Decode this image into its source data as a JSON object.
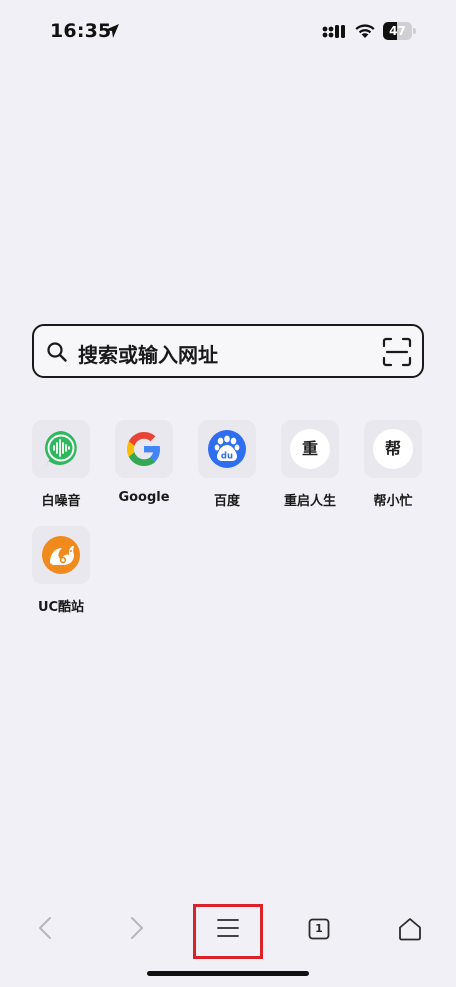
{
  "status_bar": {
    "time": "16:35",
    "battery_level": "47",
    "battery_fraction": 0.47
  },
  "search": {
    "placeholder": "搜索或输入网址"
  },
  "shortcuts": [
    {
      "label": "白噪音",
      "icon": "white-noise-app-icon",
      "color": "#2eb85c"
    },
    {
      "label": "Google",
      "icon": "google-logo-icon"
    },
    {
      "label": "百度",
      "icon": "baidu-paw-icon",
      "color": "#2e6ef0"
    },
    {
      "label": "重启人生",
      "icon": "char-icon",
      "char": "重"
    },
    {
      "label": "帮小忙",
      "icon": "char-icon",
      "char": "帮"
    },
    {
      "label": "UC酷站",
      "icon": "uc-squirrel-icon",
      "color": "#f08a1c"
    }
  ],
  "toolbar": {
    "tab_count": "1",
    "items": [
      "back-icon",
      "forward-icon",
      "menu-icon",
      "tabs-icon",
      "home-icon"
    ]
  },
  "colors": {
    "background": "#f1f0f6",
    "highlight": "#d8232a"
  }
}
